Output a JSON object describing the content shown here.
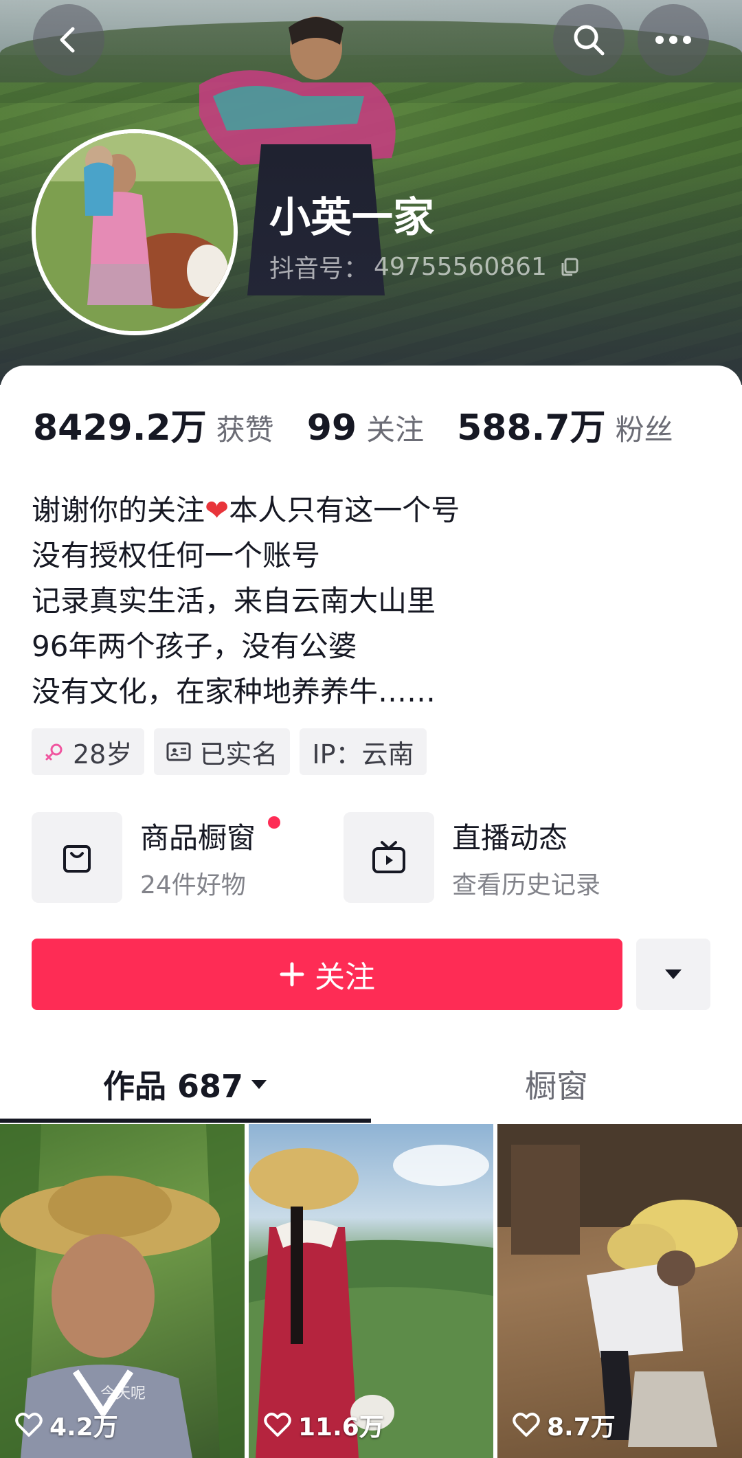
{
  "header": {
    "name": "小英一家",
    "douyin_id_label": "抖音号：",
    "douyin_id": "49755560861"
  },
  "stats": [
    {
      "value": "8429.2万",
      "label": "获赞"
    },
    {
      "value": "99",
      "label": "关注"
    },
    {
      "value": "588.7万",
      "label": "粉丝"
    }
  ],
  "bio": {
    "line1_a": "谢谢你的关注",
    "line1_heart": "❤",
    "line1_b": "本人只有这一个号",
    "line2": "没有授权任何一个账号",
    "line3": "记录真实生活，来自云南大山里",
    "line4": "96年两个孩子，没有公婆",
    "line5": "没有文化，在家种地养养牛……"
  },
  "tags": {
    "age": "28岁",
    "verified": "已实名",
    "ip": "IP：云南"
  },
  "features": {
    "shop_title": "商品橱窗",
    "shop_sub": "24件好物",
    "live_title": "直播动态",
    "live_sub": "查看历史记录"
  },
  "actions": {
    "follow_label": "关注"
  },
  "tabs": {
    "works_label": "作品 687",
    "window_label": "橱窗"
  },
  "videos": [
    {
      "likes": "4.2万",
      "caption": "今天呢"
    },
    {
      "likes": "11.6万"
    },
    {
      "likes": "8.7万"
    }
  ],
  "colors": {
    "accent": "#fe2c55",
    "text_primary": "#161823",
    "text_secondary": "#6b6c75"
  }
}
